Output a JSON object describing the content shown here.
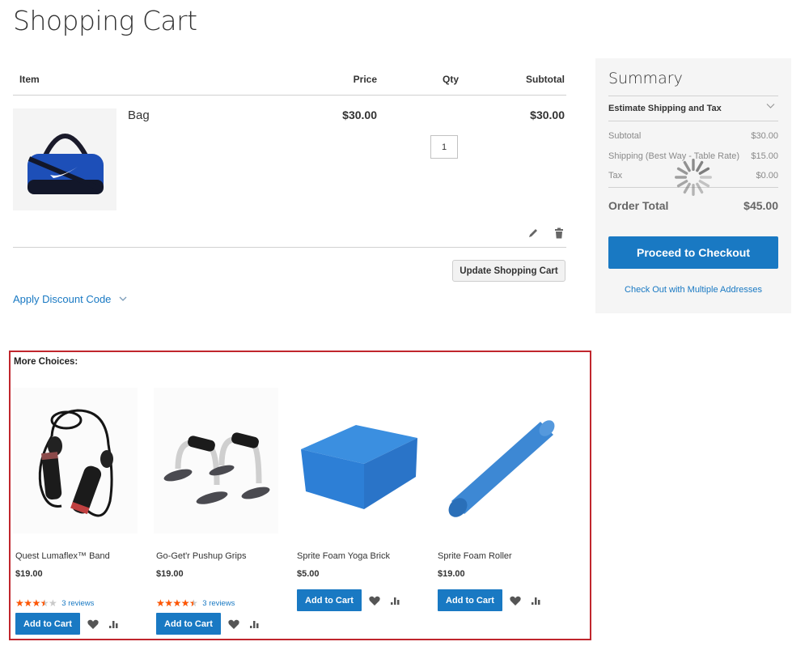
{
  "page": {
    "title": "Shopping Cart"
  },
  "cart": {
    "columns": {
      "item": "Item",
      "price": "Price",
      "qty": "Qty",
      "subtotal": "Subtotal"
    },
    "items": [
      {
        "name": "Bag",
        "price": "$30.00",
        "qty": "1",
        "subtotal": "$30.00",
        "image": "blue-duffel-bag"
      }
    ],
    "update_button": "Update Shopping Cart",
    "discount_label": "Apply Discount Code"
  },
  "summary": {
    "title": "Summary",
    "estimate_label": "Estimate Shipping and Tax",
    "rows": [
      {
        "label": "Subtotal",
        "value": "$30.00"
      },
      {
        "label": "Shipping (Best Way - Table Rate)",
        "value": "$15.00"
      },
      {
        "label": "Tax",
        "value": "$0.00"
      }
    ],
    "order_total_label": "Order Total",
    "order_total_value": "$45.00",
    "loading": true,
    "checkout_button": "Proceed to Checkout",
    "multi_address_link": "Check Out with Multiple Addresses"
  },
  "more_choices": {
    "title": "More Choices:",
    "products": [
      {
        "name": "Quest Lumaflex™ Band",
        "price": "$19.00",
        "rating": 3.5,
        "rating_max": 5,
        "reviews": "3 reviews",
        "add_label": "Add to Cart",
        "image": "resistance-band"
      },
      {
        "name": "Go-Get'r Pushup Grips",
        "price": "$19.00",
        "rating": 4.5,
        "rating_max": 5,
        "reviews": "3 reviews",
        "add_label": "Add to Cart",
        "image": "pushup-grips"
      },
      {
        "name": "Sprite Foam Yoga Brick",
        "price": "$5.00",
        "rating": null,
        "reviews": null,
        "add_label": "Add to Cart",
        "image": "yoga-brick"
      },
      {
        "name": "Sprite Foam Roller",
        "price": "$19.00",
        "rating": null,
        "reviews": null,
        "add_label": "Add to Cart",
        "image": "foam-roller"
      }
    ]
  },
  "colors": {
    "primary": "#1979c3",
    "star": "#ff5501",
    "highlight_border": "#c0262d",
    "summary_bg": "#f5f5f5"
  }
}
